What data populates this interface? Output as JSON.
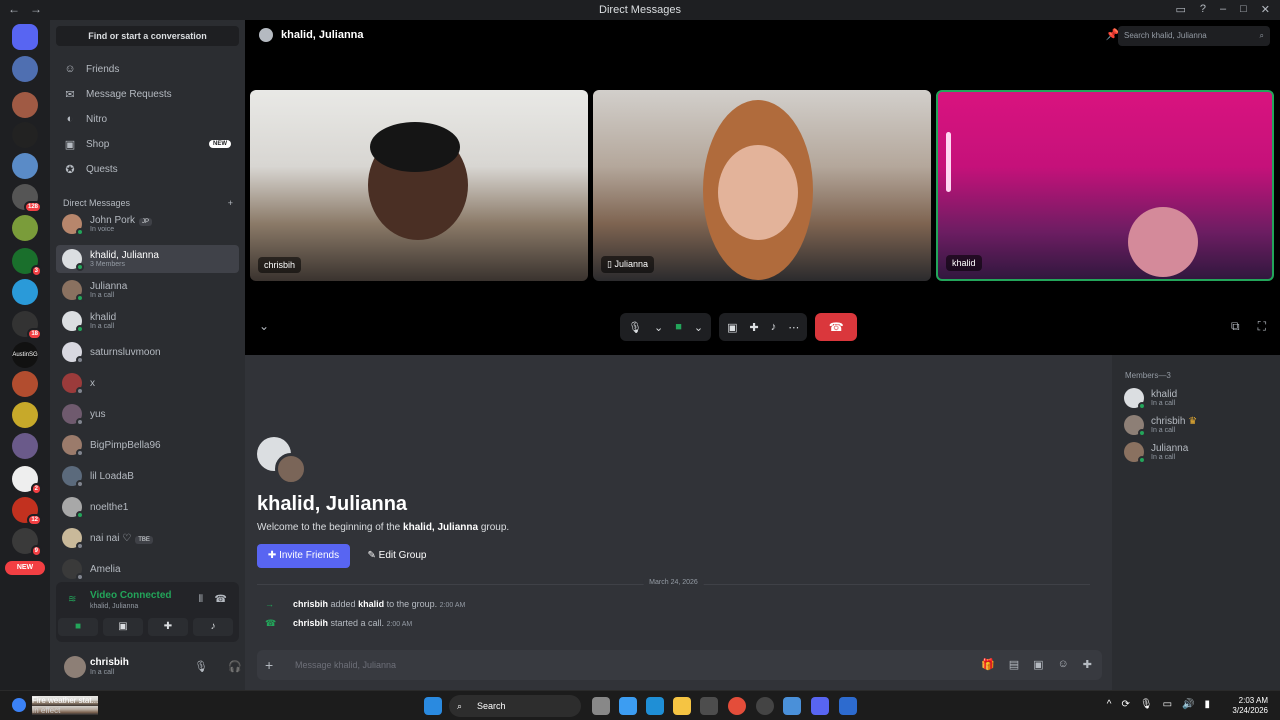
{
  "window": {
    "title": "Direct Messages"
  },
  "sidebar": {
    "search_label": "Find or start a conversation",
    "nav": [
      {
        "label": "Friends",
        "icon": "friends-icon"
      },
      {
        "label": "Message Requests",
        "icon": "mail-icon"
      },
      {
        "label": "Nitro",
        "icon": "nitro-icon"
      },
      {
        "label": "Shop",
        "icon": "shop-icon",
        "badge": "NEW"
      },
      {
        "label": "Quests",
        "icon": "quests-icon"
      }
    ],
    "dm_header": "Direct Messages",
    "dms": [
      {
        "name": "John Pork",
        "sub": "In voice",
        "tag": "JP"
      },
      {
        "name": "khalid, Julianna",
        "sub": "3 Members"
      },
      {
        "name": "Julianna",
        "sub": "In a call"
      },
      {
        "name": "khalid",
        "sub": "In a call"
      },
      {
        "name": "saturnsluvmoon",
        "sub": ""
      },
      {
        "name": "x",
        "sub": ""
      },
      {
        "name": "yus",
        "sub": ""
      },
      {
        "name": "BigPimpBella96",
        "sub": ""
      },
      {
        "name": "lil LoadaB",
        "sub": ""
      },
      {
        "name": "noelthe1",
        "sub": ""
      },
      {
        "name": "nai nai ♡",
        "sub": "",
        "tag": "TBE"
      },
      {
        "name": "Amelia",
        "sub": ""
      }
    ],
    "voice": {
      "status": "Video Connected",
      "channel": "khalid, Julianna"
    },
    "user": {
      "name": "chrisbih",
      "status": "In a call"
    }
  },
  "servers": {
    "badges": [
      "128",
      "3",
      "18",
      "2",
      "12",
      "9",
      "158"
    ],
    "new_label": "NEW",
    "text_server": "AustinSG"
  },
  "call": {
    "title": "khalid, Julianna",
    "search_placeholder": "Search khalid, Julianna",
    "tiles": [
      {
        "label": "chrisbih"
      },
      {
        "label": "Julianna"
      },
      {
        "label": "khalid"
      }
    ]
  },
  "chat": {
    "group_title": "khalid, Julianna",
    "welcome_prefix": "Welcome to the beginning of the",
    "welcome_group": "khalid, Julianna",
    "welcome_suffix": "group.",
    "invite_label": "Invite Friends",
    "edit_label": "Edit Group",
    "date": "March 24, 2026",
    "messages": [
      {
        "actor": "chrisbih",
        "verb": "added",
        "target": "khalid",
        "rest": "to the group.",
        "time": "2:00 AM"
      },
      {
        "actor": "chrisbih",
        "verb": "started a call.",
        "target": "",
        "rest": "",
        "time": "2:00 AM"
      }
    ],
    "input_placeholder": "Message khalid, Julianna"
  },
  "members": {
    "header": "Members—3",
    "list": [
      {
        "name": "khalid",
        "sub": "In a call"
      },
      {
        "name": "chrisbih",
        "sub": "In a call"
      },
      {
        "name": "Julianna",
        "sub": "In a call"
      }
    ]
  },
  "taskbar": {
    "weather_title": "Fire weather stat...",
    "weather_sub": "In effect",
    "search_label": "Search",
    "time": "2:03 AM",
    "date": "3/24/2026"
  },
  "colors": {
    "accent": "#5865f2",
    "online": "#23a55a",
    "danger": "#da373c"
  }
}
